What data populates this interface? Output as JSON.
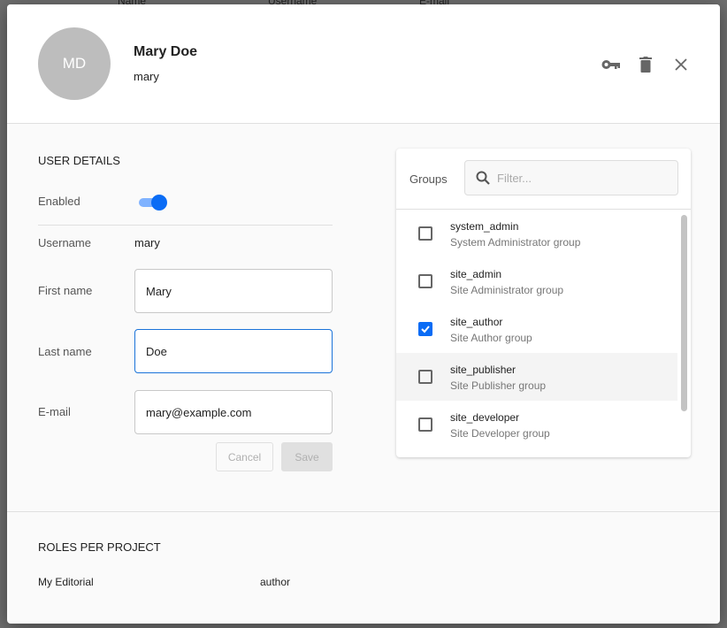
{
  "background_table": {
    "columns": [
      "Name",
      "Username",
      "E-mail"
    ]
  },
  "user": {
    "initials": "MD",
    "full_name": "Mary Doe",
    "username": "mary"
  },
  "header_actions": [
    {
      "icon": "key-icon",
      "label": "Reset password"
    },
    {
      "icon": "trash-icon",
      "label": "Delete"
    },
    {
      "icon": "close-icon",
      "label": "Close"
    }
  ],
  "details": {
    "title": "USER DETAILS",
    "enabled_label": "Enabled",
    "enabled": true,
    "username_label": "Username",
    "username_value": "mary",
    "first_name_label": "First name",
    "first_name_value": "Mary",
    "last_name_label": "Last name",
    "last_name_value": "Doe",
    "email_label": "E-mail",
    "email_value": "mary@example.com",
    "cancel_label": "Cancel",
    "save_label": "Save"
  },
  "groups": {
    "title": "Groups",
    "filter_placeholder": "Filter...",
    "items": [
      {
        "name": "system_admin",
        "description": "System Administrator group",
        "checked": false
      },
      {
        "name": "site_admin",
        "description": "Site Administrator group",
        "checked": false
      },
      {
        "name": "site_author",
        "description": "Site Author group",
        "checked": true
      },
      {
        "name": "site_publisher",
        "description": "Site Publisher group",
        "checked": false
      },
      {
        "name": "site_developer",
        "description": "Site Developer group",
        "checked": false
      }
    ]
  },
  "roles": {
    "title": "ROLES PER PROJECT",
    "rows": [
      {
        "project": "My Editorial",
        "role": "author"
      }
    ]
  },
  "colors": {
    "accent": "#0a6cf5",
    "overlay": "#6e6e6e"
  }
}
